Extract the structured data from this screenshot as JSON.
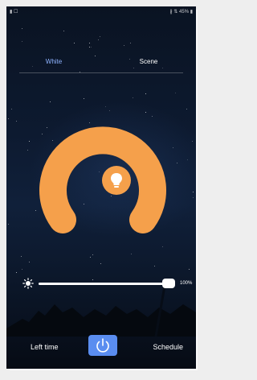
{
  "status_bar": {
    "left_text": "▮ ☐",
    "right_text": "∦ ⇅ 45% ▮"
  },
  "tabs": [
    {
      "label": "White",
      "active": true
    },
    {
      "label": "Scene",
      "active": false
    }
  ],
  "dial": {
    "color": "#f5a04b",
    "center_icon": "lightbulb-icon"
  },
  "brightness": {
    "icon": "sun-icon",
    "value_label": "100%",
    "value": 1.0
  },
  "bottom": {
    "left_time_label": "Left time",
    "power_icon": "power-icon",
    "schedule_label": "Schedule"
  },
  "colors": {
    "accent": "#5a8df0",
    "tab_active": "#8fb3ff",
    "dial": "#f5a04b"
  }
}
